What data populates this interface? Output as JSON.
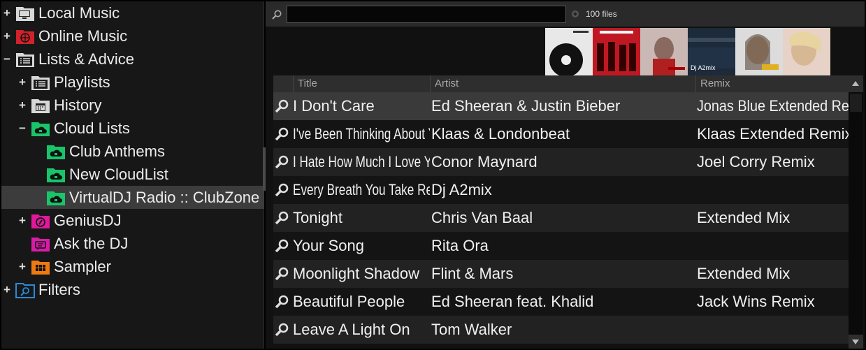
{
  "tree": {
    "items": [
      {
        "label": "Local Music",
        "icon": "computer-icon",
        "expander": "+"
      },
      {
        "label": "Online Music",
        "icon": "globe-icon",
        "expander": "+"
      },
      {
        "label": "Lists & Advice",
        "icon": "list-icon",
        "expander": "−"
      },
      {
        "label": "Playlists",
        "icon": "playlist-icon",
        "expander": "+"
      },
      {
        "label": "History",
        "icon": "calendar-icon",
        "expander": "+"
      },
      {
        "label": "Cloud Lists",
        "icon": "cloud-folder-icon",
        "expander": "−"
      },
      {
        "label": "Club Anthems",
        "icon": "cloud-folder-icon",
        "expander": ""
      },
      {
        "label": "New CloudList",
        "icon": "cloud-folder-icon",
        "expander": ""
      },
      {
        "label": "VirtualDJ Radio :: ClubZone",
        "icon": "cloud-folder-icon",
        "expander": ""
      },
      {
        "label": "GeniusDJ",
        "icon": "compass-icon",
        "expander": "+"
      },
      {
        "label": "Ask the DJ",
        "icon": "chat-icon",
        "expander": ""
      },
      {
        "label": "Sampler",
        "icon": "sampler-grid-icon",
        "expander": "+"
      },
      {
        "label": "Filters",
        "icon": "filter-search-icon",
        "expander": "+"
      }
    ]
  },
  "folders_tab": "folders",
  "search": {
    "placeholder": "",
    "value": ""
  },
  "file_count": "100 files",
  "covers": [
    {
      "caption": ""
    },
    {
      "caption": ""
    },
    {
      "caption": ""
    },
    {
      "caption": "Dj A2mix"
    },
    {
      "caption": ""
    },
    {
      "caption": ""
    }
  ],
  "table": {
    "headers": {
      "title": "Title",
      "artist": "Artist",
      "remix": "Remix"
    },
    "rows": [
      {
        "title": "I Don't Care",
        "artist": "Ed Sheeran & Justin Bieber",
        "remix": "Jonas Blue Extended Remix"
      },
      {
        "title": "I've Been Thinking About Y...",
        "artist": "Klaas & Londonbeat",
        "remix": "Klaas Extended Remix"
      },
      {
        "title": "I Hate How Much I Love Y...",
        "artist": "Conor Maynard",
        "remix": "Joel Corry Remix"
      },
      {
        "title": "Every Breath You Take Re...",
        "artist": "Dj A2mix",
        "remix": ""
      },
      {
        "title": "Tonight",
        "artist": "Chris Van Baal",
        "remix": "Extended Mix"
      },
      {
        "title": "Your Song",
        "artist": "Rita Ora",
        "remix": ""
      },
      {
        "title": "Moonlight Shadow",
        "artist": "Flint & Mars",
        "remix": "Extended Mix"
      },
      {
        "title": "Beautiful People",
        "artist": "Ed Sheeran feat. Khalid",
        "remix": "Jack Wins Remix"
      },
      {
        "title": "Leave A Light On",
        "artist": "Tom Walker",
        "remix": ""
      }
    ]
  },
  "colors": {
    "cloud": "#19c46a",
    "genius": "#e0189c",
    "ask": "#d81ca8",
    "sampler": "#f07a10",
    "online": "#d0222a",
    "filters": "#2a8ad8"
  }
}
